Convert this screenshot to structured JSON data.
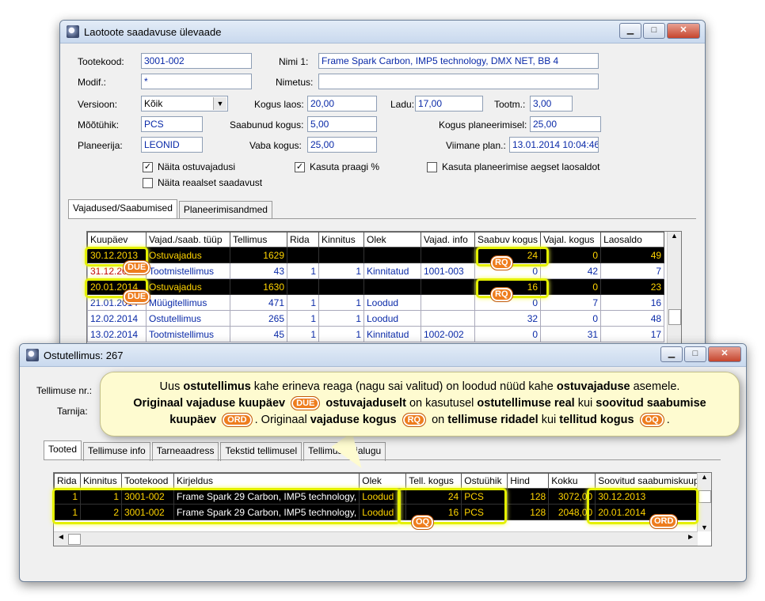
{
  "win1": {
    "title": "Laotoote saadavuse ülevaade",
    "labels": {
      "tootekood": "Tootekood:",
      "modif": "Modif.:",
      "versioon": "Versioon:",
      "mootuhik": "Mõõtühik:",
      "planeerija": "Planeerija:",
      "nimi1": "Nimi 1:",
      "nimetus": "Nimetus:",
      "kogus_laos": "Kogus laos:",
      "saabunud": "Saabunud kogus:",
      "vaba": "Vaba kogus:",
      "ladu": "Ladu:",
      "tootm": "Tootm.:",
      "kogus_plan": "Kogus planeerimisel:",
      "viimane": "Viimane plan.:"
    },
    "values": {
      "tootekood": "3001-002",
      "modif": "*",
      "versioon": "Kõik",
      "mootuhik": "PCS",
      "planeerija": "LEONID",
      "nimi1": "Frame Spark Carbon, IMP5 technology, DMX NET, BB 4",
      "nimetus": "",
      "kogus_laos": "20,00",
      "saabunud": "5,00",
      "vaba": "25,00",
      "ladu": "17,00",
      "tootm": "3,00",
      "kogus_plan": "25,00",
      "viimane": "13.01.2014 10:04:46"
    },
    "checks": {
      "naita_ostu": "Näita ostuvajadusi",
      "naita_reaal": "Näita reaalset saadavust",
      "kasuta_praagi": "Kasuta praagi %",
      "kasuta_plan": "Kasuta planeerimise aegset laosaldot"
    },
    "tabs": [
      "Vajadused/Saabumised",
      "Planeerimisandmed"
    ],
    "grid_headers": [
      "Kuupäev",
      "Vajad./saab. tüüp",
      "Tellimus",
      "Rida",
      "Kinnitus",
      "Olek",
      "Vajad. info",
      "Saabuv kogus",
      "Vajal. kogus",
      "Laosaldo"
    ],
    "rows": [
      [
        "30.12.2013",
        "Ostuvajadus",
        "1629",
        "",
        "",
        "",
        "",
        "24",
        "0",
        "49"
      ],
      [
        "31.12.2013",
        "Tootmistellimus",
        "43",
        "1",
        "1",
        "Kinnitatud",
        "1001-003",
        "0",
        "42",
        "7"
      ],
      [
        "20.01.2014",
        "Ostuvajadus",
        "1630",
        "",
        "",
        "",
        "",
        "16",
        "0",
        "23"
      ],
      [
        "21.01.2014",
        "Müügitellimus",
        "471",
        "1",
        "1",
        "Loodud",
        "",
        "0",
        "7",
        "16"
      ],
      [
        "12.02.2014",
        "Ostutellimus",
        "265",
        "1",
        "1",
        "Loodud",
        "",
        "32",
        "0",
        "48"
      ],
      [
        "13.02.2014",
        "Tootmistellimus",
        "45",
        "1",
        "1",
        "Kinnitatud",
        "1002-002",
        "0",
        "31",
        "17"
      ]
    ]
  },
  "win2": {
    "title": "Ostutellimus: 267",
    "labels": {
      "tellimuse_nr": "Tellimuse nr.:",
      "tarnija": "Tarnija:"
    },
    "tabs": [
      "Tooted",
      "Tellimuse info",
      "Tarneaadress",
      "Tekstid tellimusel",
      "Tellimuse ajalugu"
    ],
    "grid_headers": [
      "Rida",
      "Kinnitus",
      "Tootekood",
      "Kirjeldus",
      "Olek",
      "Tell. kogus",
      "Ostuühik",
      "Hind",
      "Kokku",
      "Soovitud saabumiskuup."
    ],
    "rows": [
      [
        "1",
        "1",
        "3001-002",
        "Frame Spark 29 Carbon, IMP5 technology,",
        "Loodud",
        "24",
        "PCS",
        "128",
        "3072,00",
        "30.12.2013"
      ],
      [
        "1",
        "2",
        "3001-002",
        "Frame Spark 29 Carbon, IMP5 technology,",
        "Loodud",
        "16",
        "PCS",
        "128",
        "2048,00",
        "20.01.2014"
      ]
    ]
  },
  "badges": {
    "due": "DUE",
    "rq": "RQ",
    "oq": "OQ",
    "ord": "ORD"
  },
  "callout": {
    "t1": "Uus ",
    "b1": "ostutellimus",
    "t2": " kahe erineva reaga (nagu sai valitud) on loodud nüüd kahe ",
    "b2": "ostuvajaduse",
    "t3": " asemele.",
    "b3": "Originaal vajaduse kuupäev",
    "t4": " ",
    "b4": "ostuvajaduselt",
    "t5": " on kasutusel ",
    "b5": "ostutellimuse real",
    "t6": " kui ",
    "b6": "soovitud saabumise",
    "b7": "kuupäev",
    "t7": ". Originaal ",
    "b8": "vajaduse kogus",
    "t8": " on ",
    "b9": "tellimuse ridadel",
    "t9": " kui ",
    "b10": "tellitud kogus",
    "t10": "."
  },
  "colors": {
    "highlight": "#e4f000",
    "badge": "#ee7d1e",
    "grid_text": "#0a2aa8",
    "black_row_text": "#ffd400"
  }
}
